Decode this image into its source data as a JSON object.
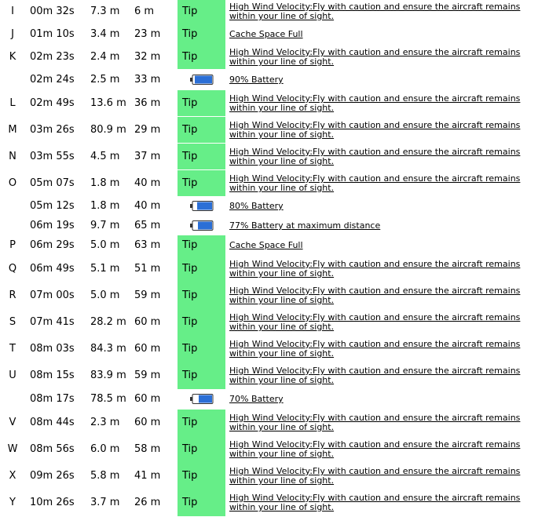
{
  "colors": {
    "tip_bg": "#66ee88",
    "battery_fill": "#2b6fd6"
  },
  "rows": [
    {
      "type": "tip",
      "mark": "I",
      "time": "00m 32s",
      "alt": "7.3 m",
      "dist": "6 m",
      "tip": "Tip",
      "message": "High Wind Velocity:Fly with caution and ensure the aircraft remains within your line of sight."
    },
    {
      "type": "tip",
      "mark": "J",
      "time": "01m 10s",
      "alt": "3.4 m",
      "dist": "23 m",
      "tip": "Tip",
      "message": "Cache Space Full"
    },
    {
      "type": "tip",
      "mark": "K",
      "time": "02m 23s",
      "alt": "2.4 m",
      "dist": "32 m",
      "tip": "Tip",
      "message": "High Wind Velocity:Fly with caution and ensure the aircraft remains within your line of sight."
    },
    {
      "type": "battery",
      "mark": "",
      "time": "02m 24s",
      "alt": "2.5 m",
      "dist": "33 m",
      "icon": "battery-icon",
      "level": 0.9,
      "message": "90% Battery"
    },
    {
      "type": "tip",
      "mark": "L",
      "time": "02m 49s",
      "alt": "13.6 m",
      "dist": "36 m",
      "tip": "Tip",
      "message": "High Wind Velocity:Fly with caution and ensure the aircraft remains within your line of sight."
    },
    {
      "type": "tip",
      "mark": "M",
      "time": "03m 26s",
      "alt": "80.9 m",
      "dist": "29 m",
      "tip": "Tip",
      "message": "High Wind Velocity:Fly with caution and ensure the aircraft remains within your line of sight."
    },
    {
      "type": "tip",
      "mark": "N",
      "time": "03m 55s",
      "alt": "4.5 m",
      "dist": "37 m",
      "tip": "Tip",
      "message": "High Wind Velocity:Fly with caution and ensure the aircraft remains within your line of sight."
    },
    {
      "type": "tip",
      "mark": "O",
      "time": "05m 07s",
      "alt": "1.8 m",
      "dist": "40 m",
      "tip": "Tip",
      "message": "High Wind Velocity:Fly with caution and ensure the aircraft remains within your line of sight."
    },
    {
      "type": "battery",
      "mark": "",
      "time": "05m 12s",
      "alt": "1.8 m",
      "dist": "40 m",
      "icon": "battery-icon",
      "level": 0.8,
      "message": "80% Battery"
    },
    {
      "type": "battery",
      "mark": "",
      "time": "06m 19s",
      "alt": "9.7 m",
      "dist": "65 m",
      "icon": "battery-icon",
      "level": 0.77,
      "message": "77% Battery at maximum distance"
    },
    {
      "type": "tip",
      "mark": "P",
      "time": "06m 29s",
      "alt": "5.0 m",
      "dist": "63 m",
      "tip": "Tip",
      "message": "Cache Space Full"
    },
    {
      "type": "tip",
      "mark": "Q",
      "time": "06m 49s",
      "alt": "5.1 m",
      "dist": "51 m",
      "tip": "Tip",
      "message": "High Wind Velocity:Fly with caution and ensure the aircraft remains within your line of sight."
    },
    {
      "type": "tip",
      "mark": "R",
      "time": "07m 00s",
      "alt": "5.0 m",
      "dist": "59 m",
      "tip": "Tip",
      "message": "High Wind Velocity:Fly with caution and ensure the aircraft remains within your line of sight."
    },
    {
      "type": "tip",
      "mark": "S",
      "time": "07m 41s",
      "alt": "28.2 m",
      "dist": "60 m",
      "tip": "Tip",
      "message": "High Wind Velocity:Fly with caution and ensure the aircraft remains within your line of sight."
    },
    {
      "type": "tip",
      "mark": "T",
      "time": "08m 03s",
      "alt": "84.3 m",
      "dist": "60 m",
      "tip": "Tip",
      "message": "High Wind Velocity:Fly with caution and ensure the aircraft remains within your line of sight."
    },
    {
      "type": "tip",
      "mark": "U",
      "time": "08m 15s",
      "alt": "83.9 m",
      "dist": "59 m",
      "tip": "Tip",
      "message": "High Wind Velocity:Fly with caution and ensure the aircraft remains within your line of sight."
    },
    {
      "type": "battery",
      "mark": "",
      "time": "08m 17s",
      "alt": "78.5 m",
      "dist": "60 m",
      "icon": "battery-icon",
      "level": 0.7,
      "message": "70% Battery"
    },
    {
      "type": "tip",
      "mark": "V",
      "time": "08m 44s",
      "alt": "2.3 m",
      "dist": "60 m",
      "tip": "Tip",
      "message": "High Wind Velocity:Fly with caution and ensure the aircraft remains within your line of sight."
    },
    {
      "type": "tip",
      "mark": "W",
      "time": "08m 56s",
      "alt": "6.0 m",
      "dist": "58 m",
      "tip": "Tip",
      "message": "High Wind Velocity:Fly with caution and ensure the aircraft remains within your line of sight."
    },
    {
      "type": "tip",
      "mark": "X",
      "time": "09m 26s",
      "alt": "5.8 m",
      "dist": "41 m",
      "tip": "Tip",
      "message": "High Wind Velocity:Fly with caution and ensure the aircraft remains within your line of sight."
    },
    {
      "type": "tip",
      "mark": "Y",
      "time": "10m 26s",
      "alt": "3.7 m",
      "dist": "26 m",
      "tip": "Tip",
      "message": "High Wind Velocity:Fly with caution and ensure the aircraft remains within your line of sight."
    }
  ]
}
